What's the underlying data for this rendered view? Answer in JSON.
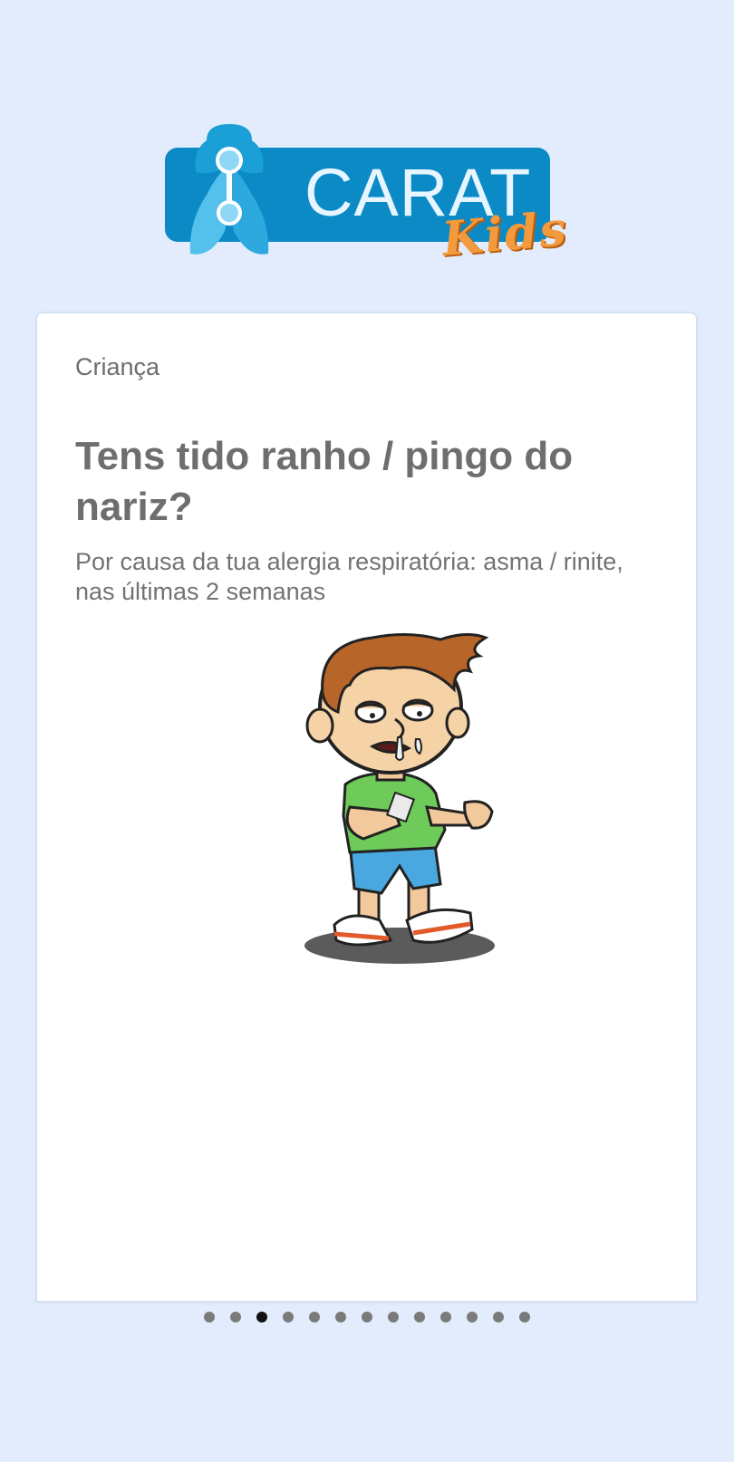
{
  "logo": {
    "text": "CARAT",
    "subtext": "Kids"
  },
  "card": {
    "category": "Criança",
    "question": "Tens tido ranho / pingo do nariz?",
    "subtitle": "Por causa da tua alergia respiratória: asma / rinite, nas últimas 2 semanas",
    "illustration_icon": "boy-runny-nose-illustration"
  },
  "pager": {
    "total": 13,
    "active_index": 2
  },
  "colors": {
    "background": "#e3ecfc",
    "logo_blue": "#0b8ac6",
    "logo_orange": "#f39a3d"
  }
}
